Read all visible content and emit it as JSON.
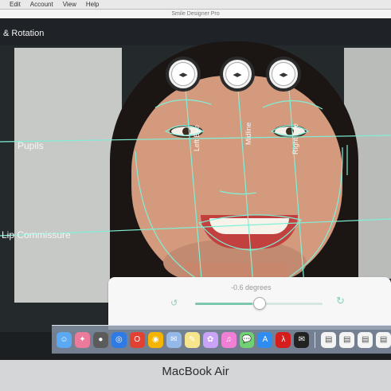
{
  "menubar": {
    "items": [
      "Edit",
      "Account",
      "View",
      "Help"
    ]
  },
  "window": {
    "title": "Smile Designer Pro"
  },
  "panel": {
    "title": "& Rotation"
  },
  "annotations": {
    "pupils_label": "Pupils",
    "lip_label": "Lip Commissure",
    "left_eye_label": "Left Eye",
    "midline_label": "Midline",
    "right_eye_label": "Right Eye"
  },
  "rotation": {
    "value_text": "-0.6 degrees",
    "value": -0.6,
    "slider_fraction": 0.45
  },
  "dock": {
    "icons": [
      "finder-icon",
      "launchpad-icon",
      "photo-icon",
      "safari-icon",
      "opera-icon",
      "chrome-icon",
      "mail-icon",
      "notes-icon",
      "photos-icon",
      "itunes-icon",
      "messages-icon",
      "app-store-icon",
      "acrobat-icon",
      "mail-dark-icon",
      "folder-1-icon",
      "folder-2-icon",
      "folder-3-icon",
      "folder-4-icon"
    ]
  },
  "bezel": {
    "brand": "MacBook Air"
  }
}
